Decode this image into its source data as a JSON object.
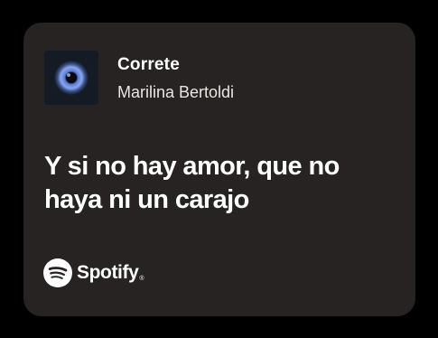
{
  "track": {
    "title": "Correte",
    "artist": "Marilina Bertoldi"
  },
  "lyric": {
    "text": "Y si no hay amor, que no haya ni un carajo"
  },
  "brand": {
    "name": "Spotify",
    "trademark": "®",
    "icon": "spotify-logo-icon"
  },
  "colors": {
    "card_background": "#262322",
    "page_background": "#000000",
    "text_primary": "#ffffff"
  }
}
